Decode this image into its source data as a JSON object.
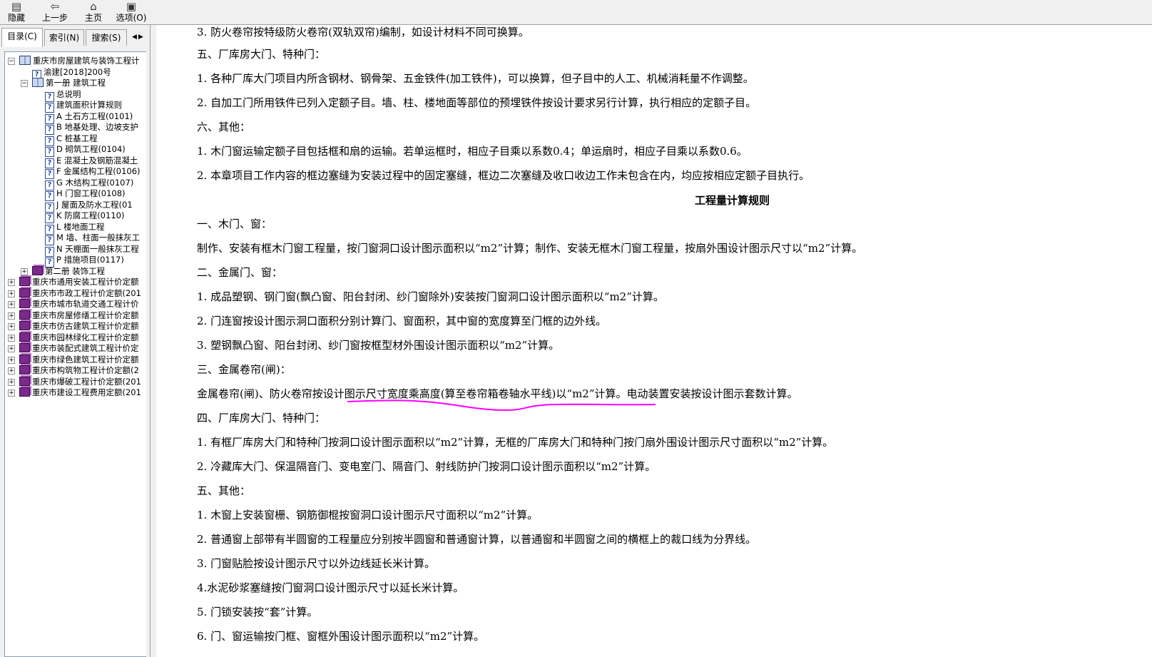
{
  "toolbar": {
    "buttons": [
      {
        "label": "隐藏",
        "icon": "hide-icon"
      },
      {
        "label": "上一步",
        "icon": "back-arrow-icon"
      },
      {
        "label": "主页",
        "icon": "home-icon"
      },
      {
        "label": "选项(O)",
        "icon": "options-icon"
      }
    ]
  },
  "tabs": [
    {
      "label": "目录(C)"
    },
    {
      "label": "索引(N)"
    },
    {
      "label": "搜索(S)"
    }
  ],
  "tree": [
    {
      "label": "重庆市房屋建筑与装饰工程计",
      "icon": "book-open-icon",
      "expander": "−"
    },
    {
      "label": "渝建[2018]200号",
      "icon": "help-page-icon"
    },
    {
      "label": "第一册  建筑工程",
      "icon": "book-open-icon",
      "expander": "−"
    },
    {
      "label": "总说明",
      "icon": "help-page-icon"
    },
    {
      "label": "建筑面积计算规则",
      "icon": "help-page-icon"
    },
    {
      "label": "A 土石方工程(0101)",
      "icon": "help-page-icon"
    },
    {
      "label": "B 地基处理、边坡支护",
      "icon": "help-page-icon"
    },
    {
      "label": "C 桩基工程",
      "icon": "help-page-icon"
    },
    {
      "label": "D 砌筑工程(0104)",
      "icon": "help-page-icon"
    },
    {
      "label": "E 混凝土及钢筋混凝土",
      "icon": "help-page-icon"
    },
    {
      "label": "F 金属结构工程(0106)",
      "icon": "help-page-icon"
    },
    {
      "label": "G 木结构工程(0107)",
      "icon": "help-page-icon"
    },
    {
      "label": "H 门窗工程(0108)",
      "icon": "help-page-icon"
    },
    {
      "label": "J 屋面及防水工程(01",
      "icon": "help-page-icon"
    },
    {
      "label": "K 防腐工程(0110)",
      "icon": "help-page-icon"
    },
    {
      "label": "L 楼地面工程",
      "icon": "help-page-icon"
    },
    {
      "label": "M 墙、柱面一般抹灰工",
      "icon": "help-page-icon"
    },
    {
      "label": "N 天棚面一般抹灰工程",
      "icon": "help-page-icon"
    },
    {
      "label": "P 措施项目(0117)",
      "icon": "help-page-icon"
    },
    {
      "label": "第二册  装饰工程",
      "icon": "book-closed-icon",
      "expander": "+"
    },
    {
      "label": "重庆市通用安装工程计价定额",
      "icon": "book-closed-icon",
      "expander": "+"
    },
    {
      "label": "重庆市市政工程计价定额(201",
      "icon": "book-closed-icon",
      "expander": "+"
    },
    {
      "label": "重庆市城市轨道交通工程计价",
      "icon": "book-closed-icon",
      "expander": "+"
    },
    {
      "label": "重庆市房屋修缮工程计价定额",
      "icon": "book-closed-icon",
      "expander": "+"
    },
    {
      "label": "重庆市仿古建筑工程计价定额",
      "icon": "book-closed-icon",
      "expander": "+"
    },
    {
      "label": "重庆市园林绿化工程计价定额",
      "icon": "book-closed-icon",
      "expander": "+"
    },
    {
      "label": "重庆市装配式建筑工程计价定",
      "icon": "book-closed-icon",
      "expander": "+"
    },
    {
      "label": "重庆市绿色建筑工程计价定额",
      "icon": "book-closed-icon",
      "expander": "+"
    },
    {
      "label": "重庆市构筑物工程计价定额(2",
      "icon": "book-closed-icon",
      "expander": "+"
    },
    {
      "label": "重庆市爆破工程计价定额(201",
      "icon": "book-closed-icon",
      "expander": "+"
    },
    {
      "label": "重庆市建设工程费用定额(201",
      "icon": "book-closed-icon",
      "expander": "+"
    }
  ],
  "content": {
    "lines": [
      "3. 防火卷帘按特级防火卷帘(双轨双帘)编制，如设计材料不同可换算。",
      "五、厂库房大门、特种门：",
      "1. 各种厂库大门项目内所含钢材、钢骨架、五金铁件(加工铁件)，可以换算，但子目中的人工、机械消耗量不作调整。",
      "2. 自加工门所用铁件已列入定额子目。墙、柱、楼地面等部位的预埋铁件按设计要求另行计算，执行相应的定额子目。",
      "六、其他：",
      "1. 木门窗运输定额子目包括框和扇的运输。若单运框时，相应子目乘以系数0.4；单运扇时，相应子目乘以系数0.6。",
      "2. 本章项目工作内容的框边塞缝为安装过程中的固定塞缝，框边二次塞缝及收口收边工作未包含在内，均应按相应定额子目执行。"
    ],
    "heading": "工程量计算规则",
    "lines2": [
      "一、木门、窗：",
      "制作、安装有框木门窗工程量，按门窗洞口设计图示面积以“m2”计算；制作、安装无框木门窗工程量，按扇外围设计图示尺寸以“m2”计算。",
      "二、金属门、窗：",
      "1. 成品塑钢、钢门窗(飘凸窗、阳台封闭、纱门窗除外)安装按门窗洞口设计图示面积以“m2”计算。",
      "2. 门连窗按设计图示洞口面积分别计算门、窗面积，其中窗的宽度算至门框的边外线。",
      "3. 塑钢飘凸窗、阳台封闭、纱门窗按框型材外围设计图示面积以“m2”计算。",
      "三、金属卷帘(闸)：",
      "金属卷帘(闸)、防火卷帘按设计图示尺寸宽度乘高度(算至卷帘箱卷轴水平线)以“m2”计算。电动装置安装按设计图示套数计算。",
      "四、厂库房大门、特种门：",
      "1. 有框厂库房大门和特种门按洞口设计图示面积以“m2”计算，无框的厂库房大门和特种门按门扇外围设计图示尺寸面积以“m2”计算。",
      "2. 冷藏库大门、保温隔音门、变电室门、隔音门、射线防护门按洞口设计图示面积以“m2”计算。",
      "五、其他：",
      "1. 木窗上安装窗栅、钢筋御棍按窗洞口设计图示尺寸面积以“m2”计算。",
      "2. 普通窗上部带有半圆窗的工程量应分别按半圆窗和普通窗计算，以普通窗和半圆窗之间的横框上的裁口线为分界线。",
      "3. 门窗贴脸按设计图示尺寸以外边线延长米计算。",
      "4.水泥砂浆塞缝按门窗洞口设计图示尺寸以延长米计算。",
      "5. 门锁安装按“套”计算。",
      "6. 门、窗运输按门框、窗框外围设计图示面积以“m2”计算。"
    ]
  },
  "annotation_color": "#ff00ff"
}
